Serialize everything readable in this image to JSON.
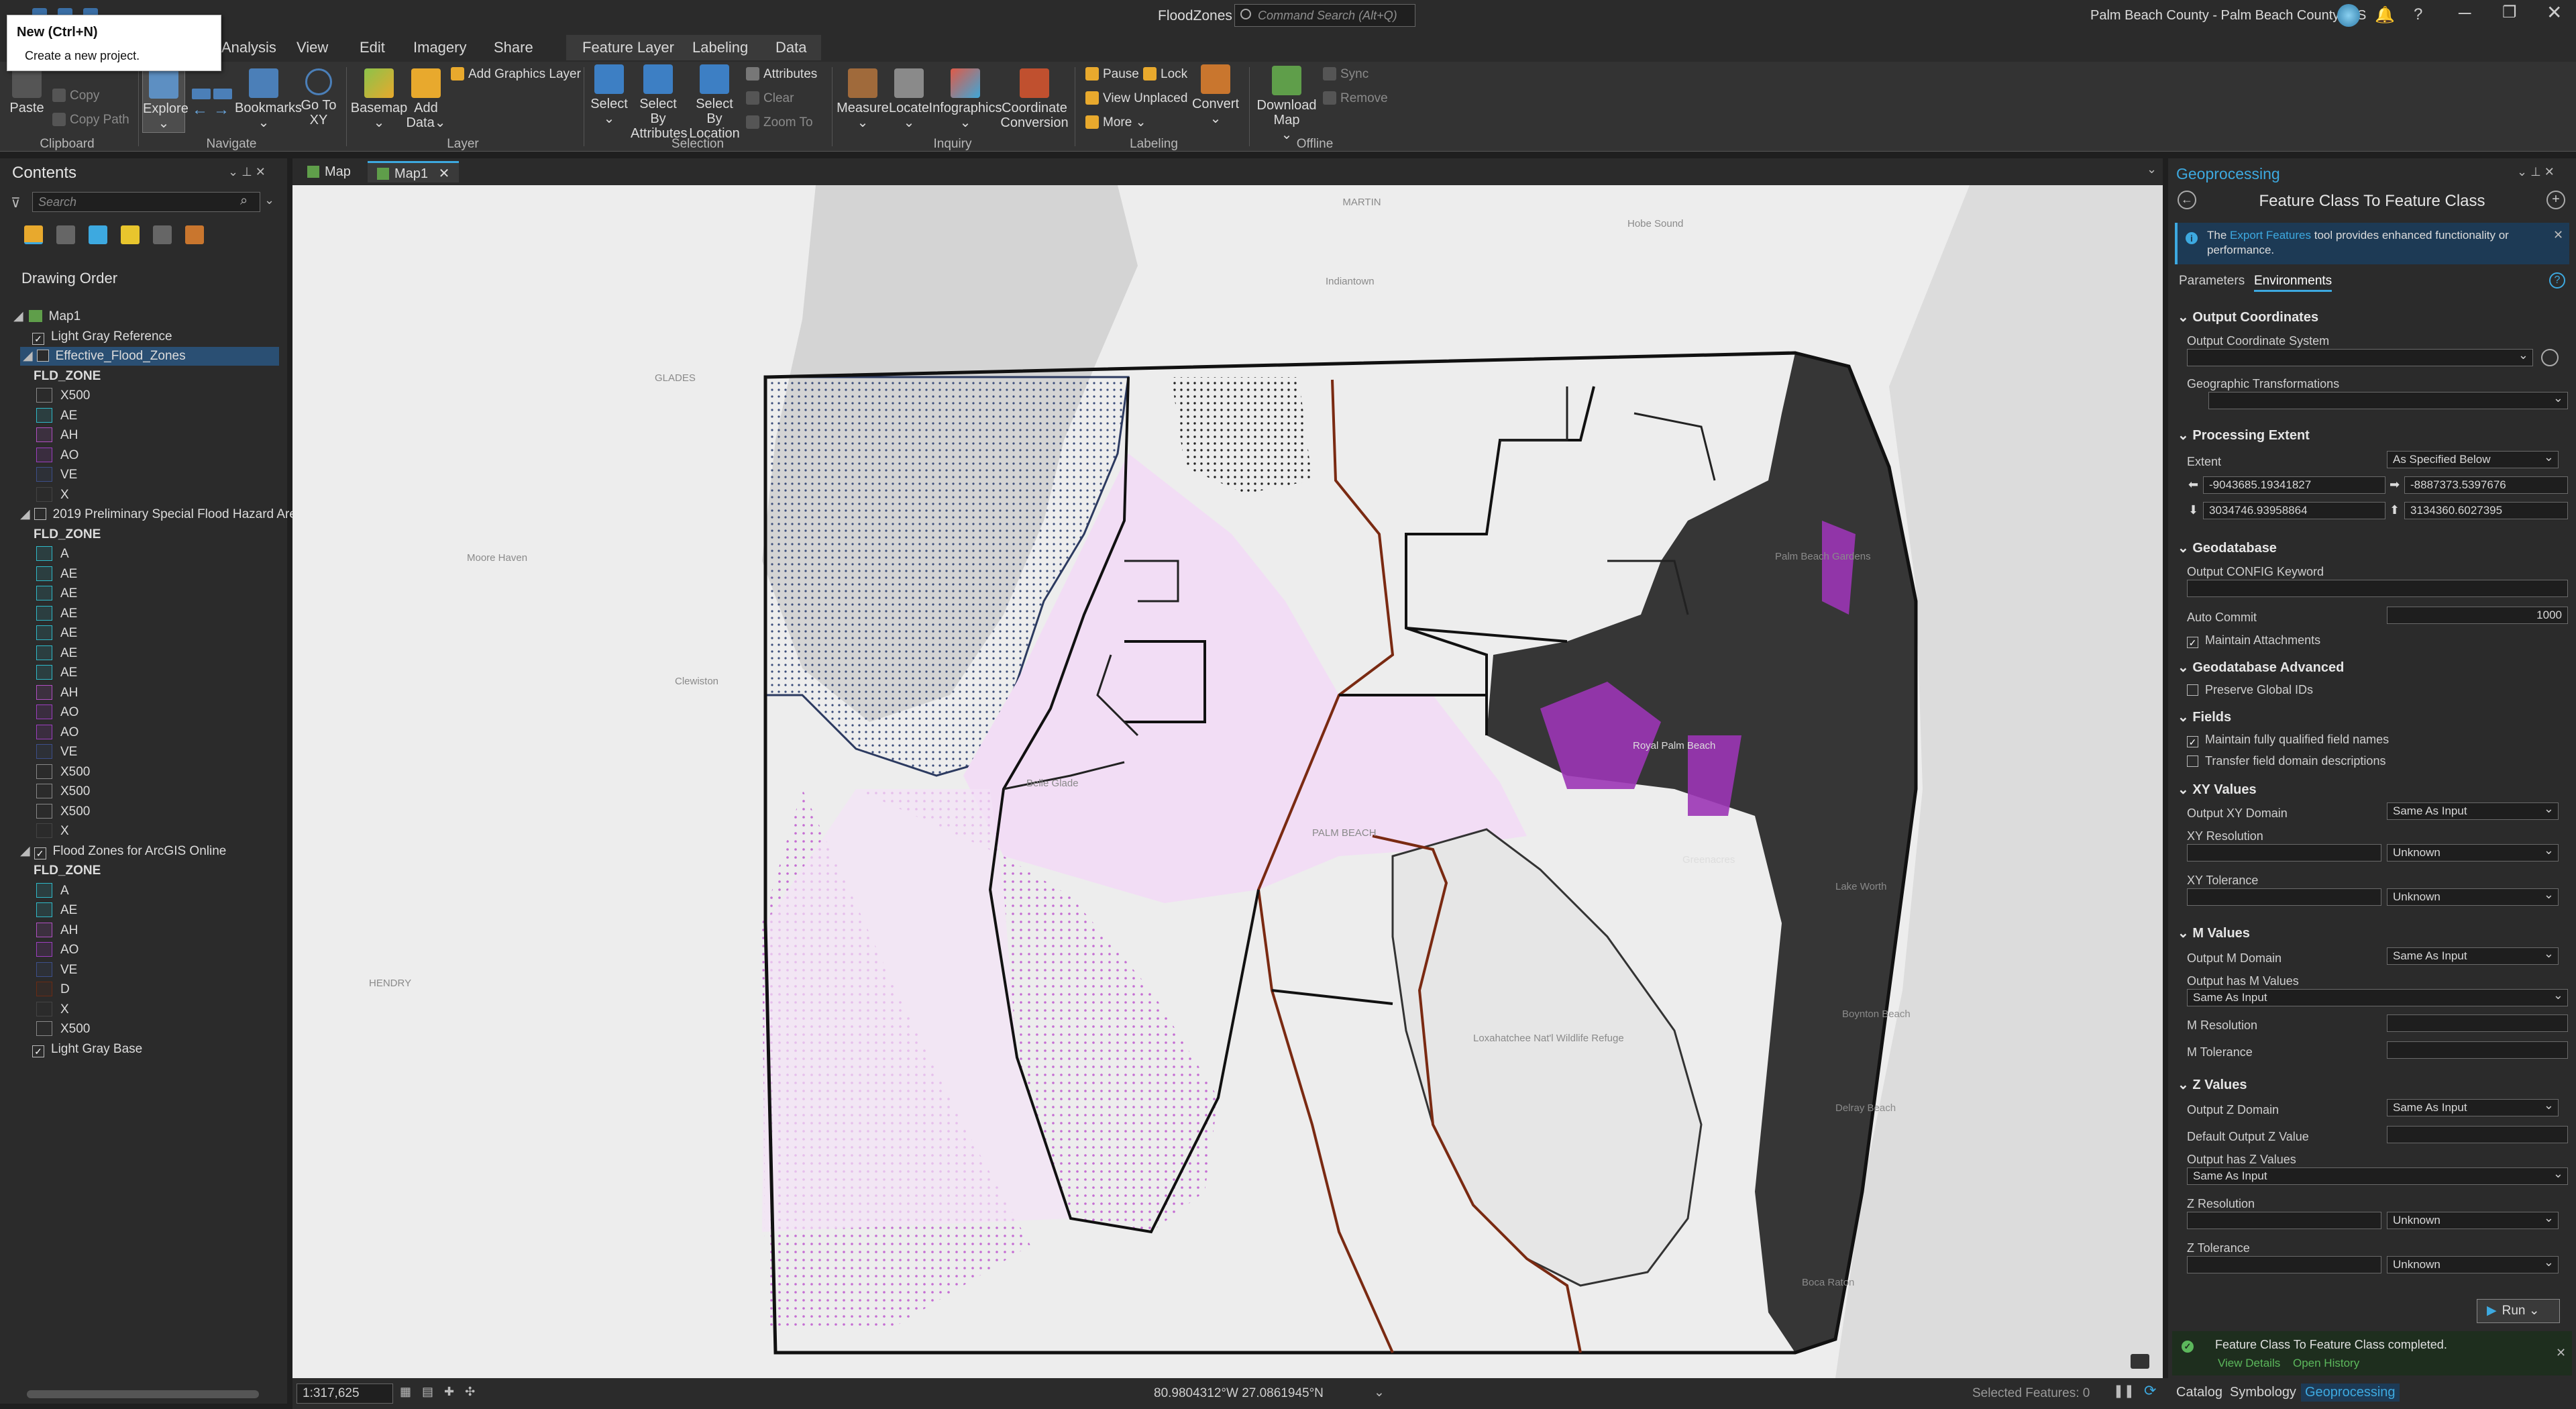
{
  "titlebar": {
    "project": "FloodZones",
    "command_search": "Command Search (Alt+Q)",
    "portal": "Palm Beach County - Palm Beach County GIS"
  },
  "tooltip": {
    "title": "New (Ctrl+N)",
    "body": "Create a new project."
  },
  "ribbon_tabs": [
    "Analysis",
    "View",
    "Edit",
    "Imagery",
    "Share"
  ],
  "context_tabs": [
    "Feature Layer",
    "Labeling",
    "Data"
  ],
  "ribbon": {
    "clipboard": {
      "paste": "Paste",
      "copy": "Copy",
      "copy_path": "Copy Path",
      "group": "Clipboard"
    },
    "navigate": {
      "explore": "Explore",
      "bookmarks": "Bookmarks",
      "goto": "Go To XY",
      "group": "Navigate"
    },
    "layer": {
      "basemap": "Basemap",
      "add_data": "Add Data",
      "add_graphics": "Add Graphics Layer",
      "group": "Layer"
    },
    "selection": {
      "select": "Select",
      "by_attr": "Select By Attributes",
      "by_loc": "Select By Location",
      "attributes": "Attributes",
      "clear": "Clear",
      "zoom_to": "Zoom To",
      "group": "Selection"
    },
    "inquiry": {
      "measure": "Measure",
      "locate": "Locate",
      "infographics": "Infographics",
      "coord": "Coordinate Conversion",
      "group": "Inquiry"
    },
    "labeling": {
      "pause": "Pause",
      "lock": "Lock",
      "view_unplaced": "View Unplaced",
      "more": "More",
      "convert": "Convert",
      "group": "Labeling"
    },
    "offline": {
      "download": "Download Map",
      "sync": "Sync",
      "remove": "Remove",
      "group": "Offline"
    }
  },
  "contents": {
    "title": "Contents",
    "search_placeholder": "Search",
    "drawing_order": "Drawing Order",
    "map": "Map1",
    "layers": [
      {
        "name": "Light Gray Reference",
        "checked": true
      },
      {
        "name": "Effective_Flood_Zones",
        "checked": false,
        "selected": true
      },
      {
        "name": "2019 Preliminary Special Flood Hazard Area",
        "checked": false
      },
      {
        "name": "Flood Zones for ArcGIS Online",
        "checked": true
      },
      {
        "name": "Light Gray Base",
        "checked": true
      }
    ],
    "field": "FLD_ZONE",
    "legend1": [
      "X500",
      "AE",
      "AH",
      "AO",
      "VE",
      "X"
    ],
    "legend2": [
      "A",
      "AE",
      "AE",
      "AE",
      "AE",
      "AE",
      "AE",
      "AH",
      "AO",
      "AO",
      "VE",
      "X500",
      "X500",
      "X500",
      "X"
    ],
    "legend3": [
      "A",
      "AE",
      "AH",
      "AO",
      "VE",
      "D",
      "X",
      "X500"
    ]
  },
  "map_tabs": [
    "Map",
    "Map1"
  ],
  "map_labels": {
    "martin": "MARTIN",
    "hobe": "Hobe Sound",
    "indiantown": "Indiantown",
    "glades": "GLADES",
    "moore": "Moore Haven",
    "clewiston": "Clewiston",
    "pbg": "Palm Beach Gardens",
    "belle": "Belle Glade",
    "palmbeach": "PALM BEACH",
    "hendry": "HENDRY",
    "lox": "Loxahatchee Nat'l Wildlife Refuge",
    "boynton": "Boynton Beach",
    "delray": "Delray Beach",
    "boca": "Boca Raton",
    "royal": "Royal Palm Beach",
    "greenacres": "Greenacres",
    "lakeworth": "Lake Worth"
  },
  "status": {
    "scale": "1:317,625",
    "coords": "80.9804312°W 27.0861945°N",
    "selected": "Selected Features: 0"
  },
  "gp": {
    "pane_title": "Geoprocessing",
    "tool_title": "Feature Class To Feature Class",
    "info_pre": "The",
    "info_link": "Export Features",
    "info_post": "tool provides enhanced functionality or performance.",
    "tab_params": "Parameters",
    "tab_env": "Environments",
    "sec_output_coords": "Output Coordinates",
    "lbl_ocs": "Output Coordinate System",
    "lbl_geo_tr": "Geographic Transformations",
    "sec_extent": "Processing Extent",
    "lbl_extent": "Extent",
    "extent_value": "As Specified Below",
    "ext_left": "-9043685.19341827",
    "ext_right": "-8887373.5397676",
    "ext_bottom": "3034746.93958864",
    "ext_top": "3134360.6027395",
    "sec_gdb": "Geodatabase",
    "lbl_config": "Output CONFIG Keyword",
    "lbl_autocommit": "Auto Commit",
    "autocommit": "1000",
    "chk_attach": "Maintain Attachments",
    "sec_gdb_adv": "Geodatabase Advanced",
    "chk_globalids": "Preserve Global IDs",
    "sec_fields": "Fields",
    "chk_qualified": "Maintain fully qualified field names",
    "chk_domain": "Transfer field domain descriptions",
    "sec_xy": "XY Values",
    "lbl_xy_domain": "Output XY Domain",
    "xy_domain": "Same As Input",
    "lbl_xy_res": "XY Resolution",
    "xy_res_unit": "Unknown",
    "lbl_xy_tol": "XY Tolerance",
    "xy_tol_unit": "Unknown",
    "sec_m": "M Values",
    "lbl_m_domain": "Output M Domain",
    "m_domain": "Same As Input",
    "lbl_has_m": "Output has M Values",
    "has_m": "Same As Input",
    "lbl_m_res": "M Resolution",
    "lbl_m_tol": "M Tolerance",
    "sec_z": "Z Values",
    "lbl_z_domain": "Output Z Domain",
    "z_domain": "Same As Input",
    "lbl_def_z": "Default Output Z Value",
    "lbl_has_z": "Output has Z Values",
    "has_z": "Same As Input",
    "lbl_z_res": "Z Resolution",
    "z_res_unit": "Unknown",
    "lbl_z_tol": "Z Tolerance",
    "z_tol_unit": "Unknown",
    "run": "Run",
    "done_msg": "Feature Class To Feature Class completed.",
    "view_details": "View Details",
    "open_history": "Open History"
  },
  "bottom_tabs": [
    "Catalog",
    "Symbology",
    "Geoprocessing"
  ],
  "colors": {
    "accent": "#3da9e0",
    "selected_row": "#2a4f73",
    "success": "#5cb85c"
  }
}
